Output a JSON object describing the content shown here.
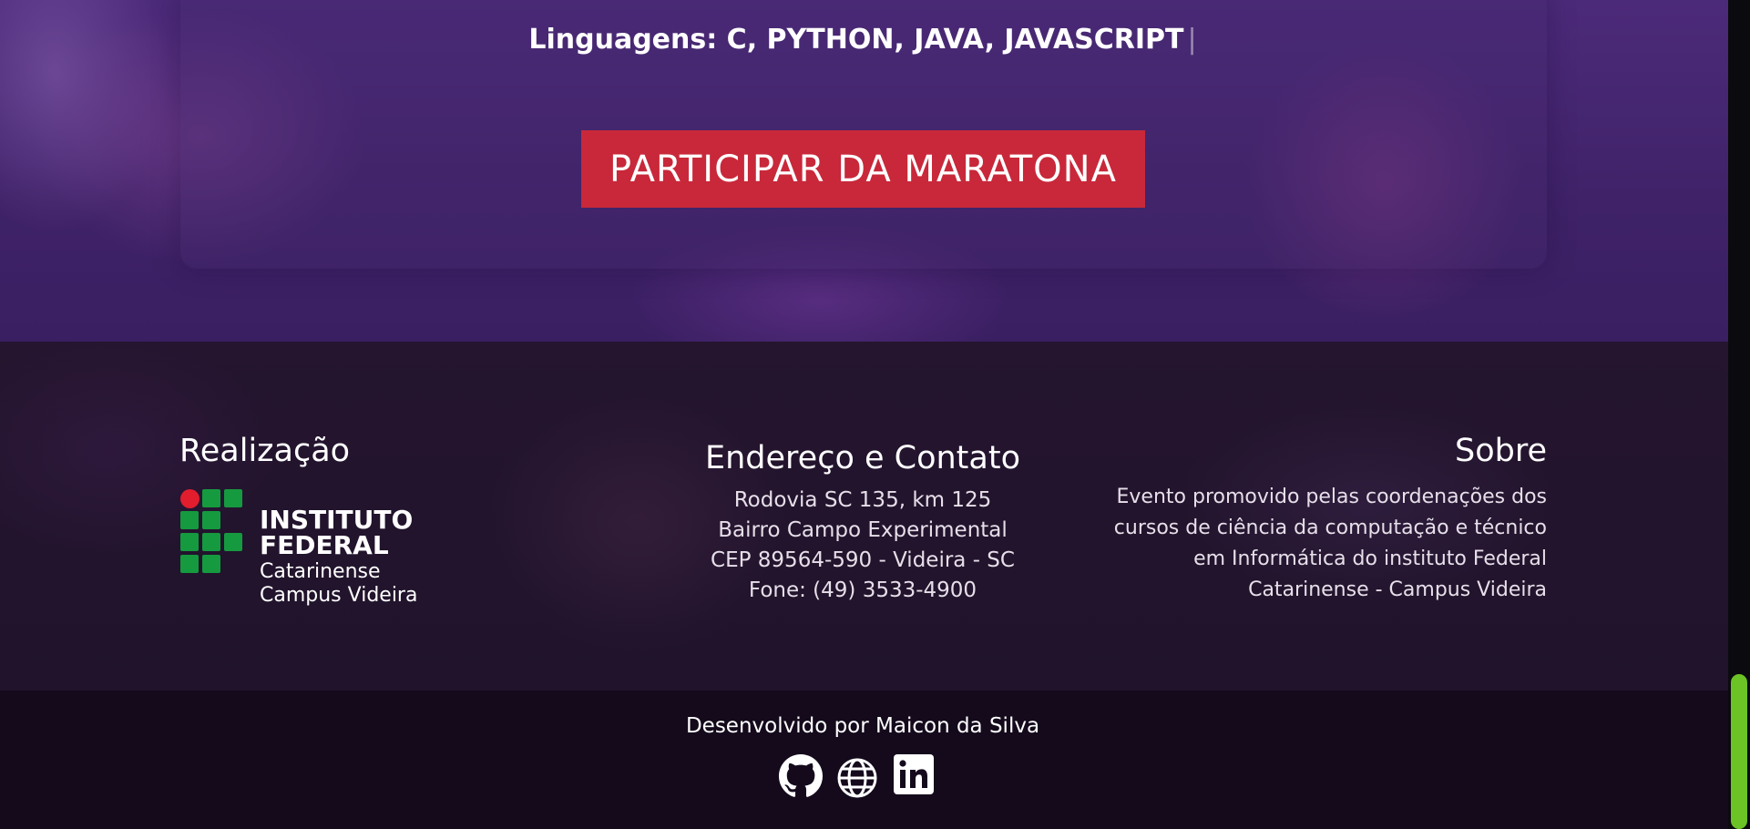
{
  "hero": {
    "languages": "Linguagens: C, PYTHON, JAVA, JAVASCRIPT",
    "caret": "|",
    "cta_label": "PARTICIPAR DA MARATONA"
  },
  "footer": {
    "realizacao": {
      "title": "Realização",
      "logo_line1": "INSTITUTO FEDERAL",
      "logo_line2": "Catarinense",
      "logo_line3": "Campus Videira"
    },
    "contato": {
      "title": "Endereço e Contato",
      "lines": [
        "Rodovia SC 135, km 125",
        "Bairro Campo Experimental",
        "CEP 89564-590 - Videira - SC",
        "Fone: (49) 3533-4900"
      ]
    },
    "sobre": {
      "title": "Sobre",
      "text": "Evento promovido pelas coordenações dos cursos de ciência da computação e técnico em Informática do instituto Federal Catarinense - Campus Videira"
    }
  },
  "bottom": {
    "developer": "Desenvolvido por Maicon da Silva",
    "social": [
      "github-icon",
      "globe-icon",
      "linkedin-icon"
    ]
  },
  "colors": {
    "cta": "#c8283a",
    "logo_green": "#159a3f",
    "logo_red": "#e21d2e",
    "scroll_thumb": "#6cc325"
  }
}
